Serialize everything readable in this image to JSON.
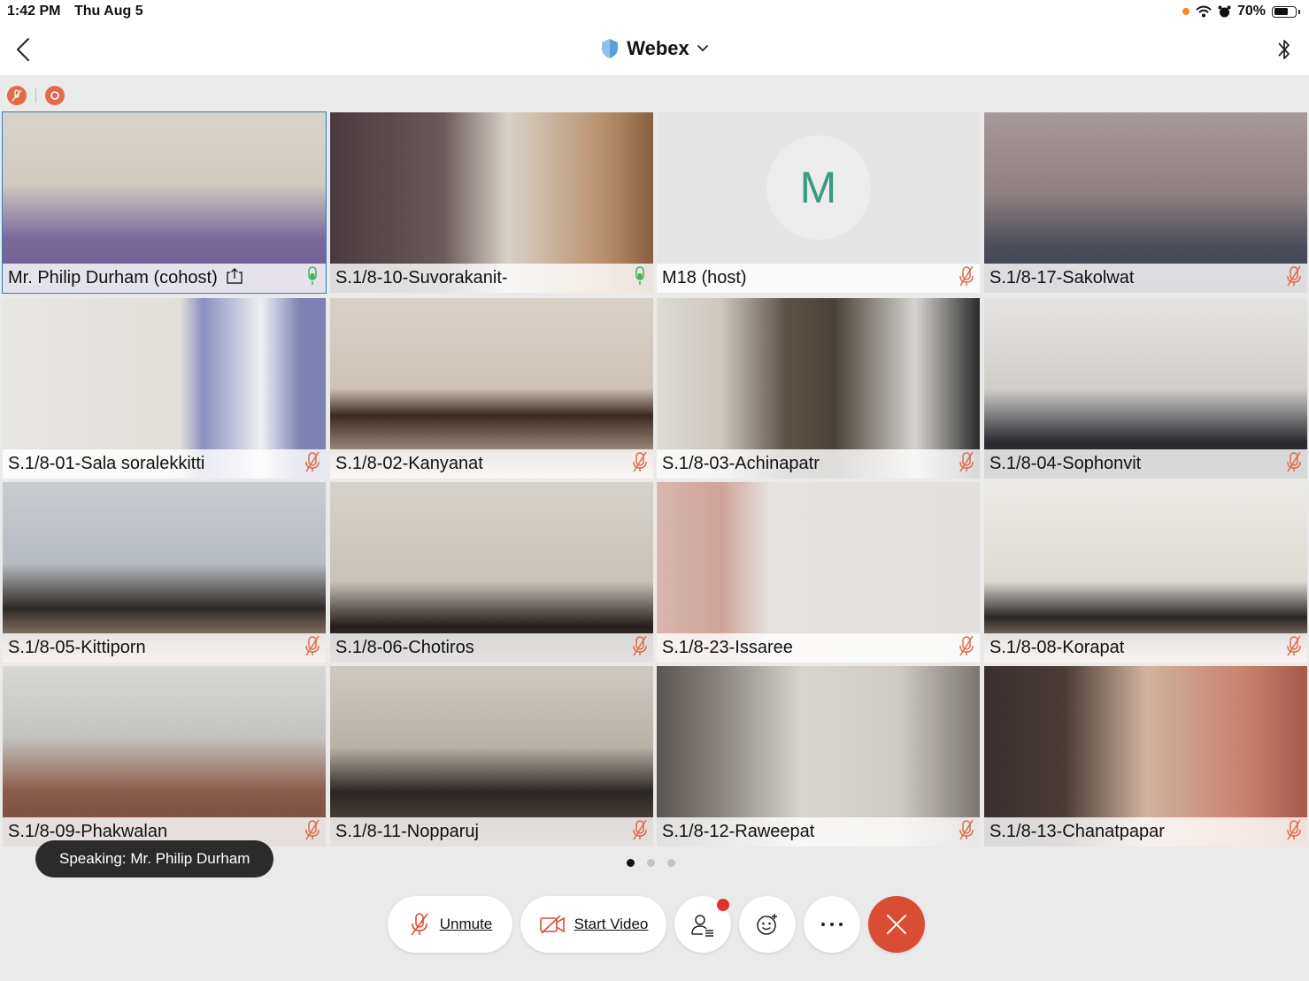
{
  "status_bar": {
    "time": "1:42 PM",
    "date": "Thu Aug 5",
    "battery": "70%",
    "battery_level": 0.7
  },
  "nav": {
    "title": "Webex",
    "icons": [
      "back-chevron-icon",
      "shield-icon",
      "chevron-down-icon",
      "bluetooth-icon"
    ]
  },
  "indicators": [
    "muted-indicator-icon",
    "recording-indicator-icon"
  ],
  "participants": [
    {
      "name": "Mr. Philip Durham (cohost)",
      "mic": "active",
      "sharing": true,
      "active_speaker": true
    },
    {
      "name": "S.1/8-10-Suvorakanit-",
      "mic": "active"
    },
    {
      "name": "M18 (host)",
      "mic": "muted",
      "avatar": "M"
    },
    {
      "name": "S.1/8-17-Sakolwat",
      "mic": "muted"
    },
    {
      "name": "S.1/8-01-Sala soralekkitti",
      "mic": "muted"
    },
    {
      "name": "S.1/8-02-Kanyanat",
      "mic": "muted"
    },
    {
      "name": "S.1/8-03-Achinapatr",
      "mic": "muted"
    },
    {
      "name": "S.1/8-04-Sophonvit",
      "mic": "muted"
    },
    {
      "name": "S.1/8-05-Kittiporn",
      "mic": "muted"
    },
    {
      "name": "S.1/8-06-Chotiros",
      "mic": "muted"
    },
    {
      "name": "S.1/8-23-Issaree",
      "mic": "muted"
    },
    {
      "name": "S.1/8-08-Korapat",
      "mic": "muted"
    },
    {
      "name": "S.1/8-09-Phakwalan",
      "mic": "muted"
    },
    {
      "name": "S.1/8-11-Nopparuj",
      "mic": "muted"
    },
    {
      "name": "S.1/8-12-Raweepat",
      "mic": "muted"
    },
    {
      "name": "S.1/8-13-Chanatpapar",
      "mic": "muted"
    }
  ],
  "speaking": "Speaking: Mr. Philip Durham",
  "pager": {
    "pages": 3,
    "current": 1
  },
  "controls": {
    "unmute_label": "Unmute",
    "start_video_label": "Start Video",
    "icons": [
      "mic-muted-icon",
      "video-off-icon",
      "participants-icon",
      "reactions-icon",
      "more-icon",
      "end-call-icon"
    ]
  },
  "colors": {
    "accent": "#2d7fbf",
    "muted": "#e06a4a",
    "unmuted": "#3fb35a",
    "end_call": "#d94d35",
    "avatar_letter": "#3a9a84"
  }
}
